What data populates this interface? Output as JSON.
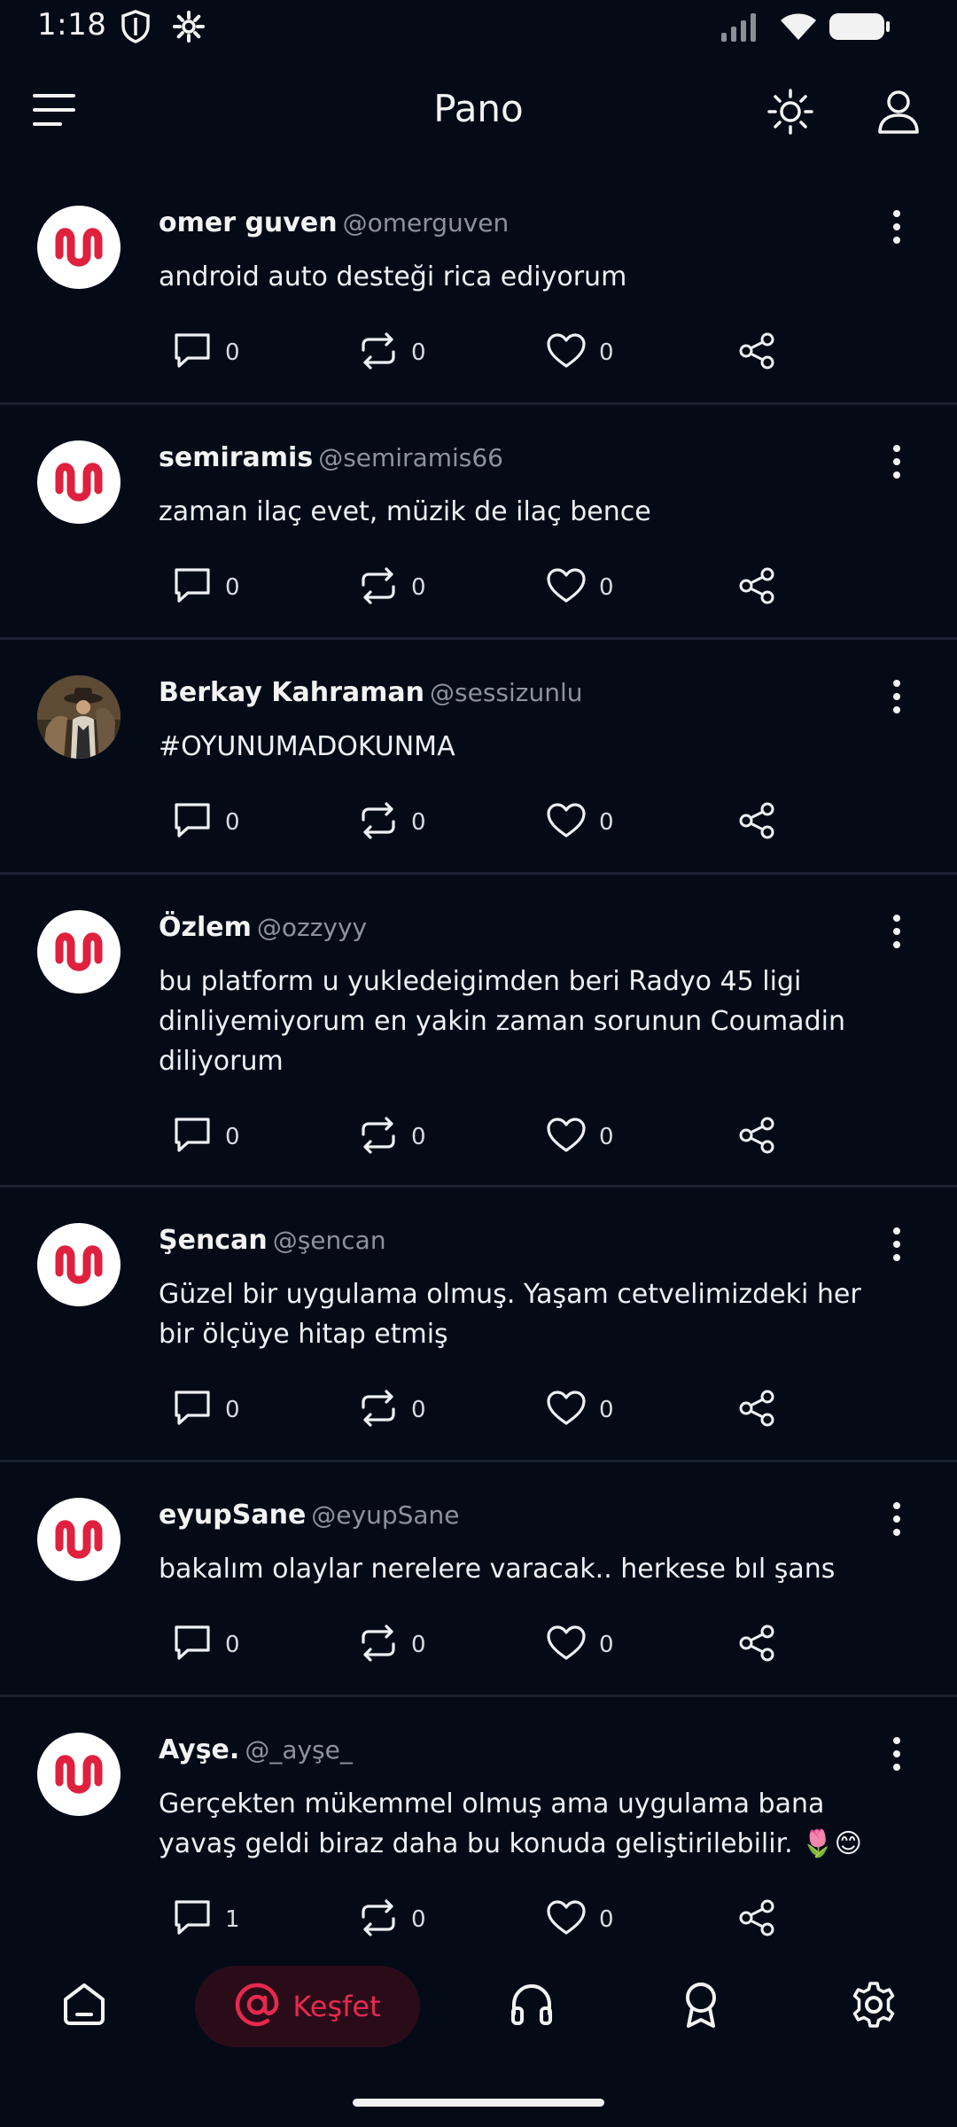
{
  "status_bar": {
    "time": "1:18",
    "icons": [
      "shield-icon",
      "gear-icon",
      "signal-icon",
      "wifi-icon",
      "battery-icon"
    ]
  },
  "header": {
    "title": "Pano",
    "icons": [
      "menu-icon",
      "sun-icon",
      "user-icon"
    ]
  },
  "colors": {
    "background": "#040b17",
    "accent": "#e8294f",
    "divider": "#1a2130",
    "muted": "#8d929b"
  },
  "posts": [
    {
      "name": "omer guven",
      "handle": "@omerguven",
      "text": "android auto desteği rica ediyorum",
      "comments": "0",
      "reposts": "0",
      "likes": "0",
      "avatar": "logo"
    },
    {
      "name": "semiramis",
      "handle": "@semiramis66",
      "text": "zaman ilaç evet, müzik de ilaç bence",
      "comments": "0",
      "reposts": "0",
      "likes": "0",
      "avatar": "logo"
    },
    {
      "name": "Berkay Kahraman",
      "handle": "@sessizunlu",
      "text": "#OYUNUMADOKUNMA",
      "comments": "0",
      "reposts": "0",
      "likes": "0",
      "avatar": "photo"
    },
    {
      "name": "Özlem",
      "handle": "@ozzyyy",
      "text": "bu platform u yukledeigimden beri Radyo 45 ligi dinliyemiyorum en yakin zaman sorunun Coumadin diliyorum",
      "comments": "0",
      "reposts": "0",
      "likes": "0",
      "avatar": "logo"
    },
    {
      "name": "Şencan",
      "handle": "@şencan",
      "text": "Güzel bir uygulama olmuş. Yaşam cetvelimizdeki her bir ölçüye hitap etmiş",
      "comments": "0",
      "reposts": "0",
      "likes": "0",
      "avatar": "logo"
    },
    {
      "name": "eyupSane",
      "handle": "@eyupSane",
      "text": "bakalım olaylar nerelere varacak.. herkese bıl şans",
      "comments": "0",
      "reposts": "0",
      "likes": "0",
      "avatar": "logo"
    },
    {
      "name": "Ayşe.",
      "handle": "@_ayşe_",
      "text": "Gerçekten mükemmel olmuş ama uygulama bana yavaş geldi biraz daha bu konuda geliştirilebilir. 🌷😊",
      "comments": "1",
      "reposts": "0",
      "likes": "0",
      "avatar": "logo"
    }
  ],
  "bottom_nav": {
    "items": [
      {
        "icon": "home-icon"
      },
      {
        "icon": "at-icon",
        "label": "Keşfet",
        "active": true
      },
      {
        "icon": "headphones-icon"
      },
      {
        "icon": "badge-icon"
      },
      {
        "icon": "settings-icon"
      }
    ]
  }
}
